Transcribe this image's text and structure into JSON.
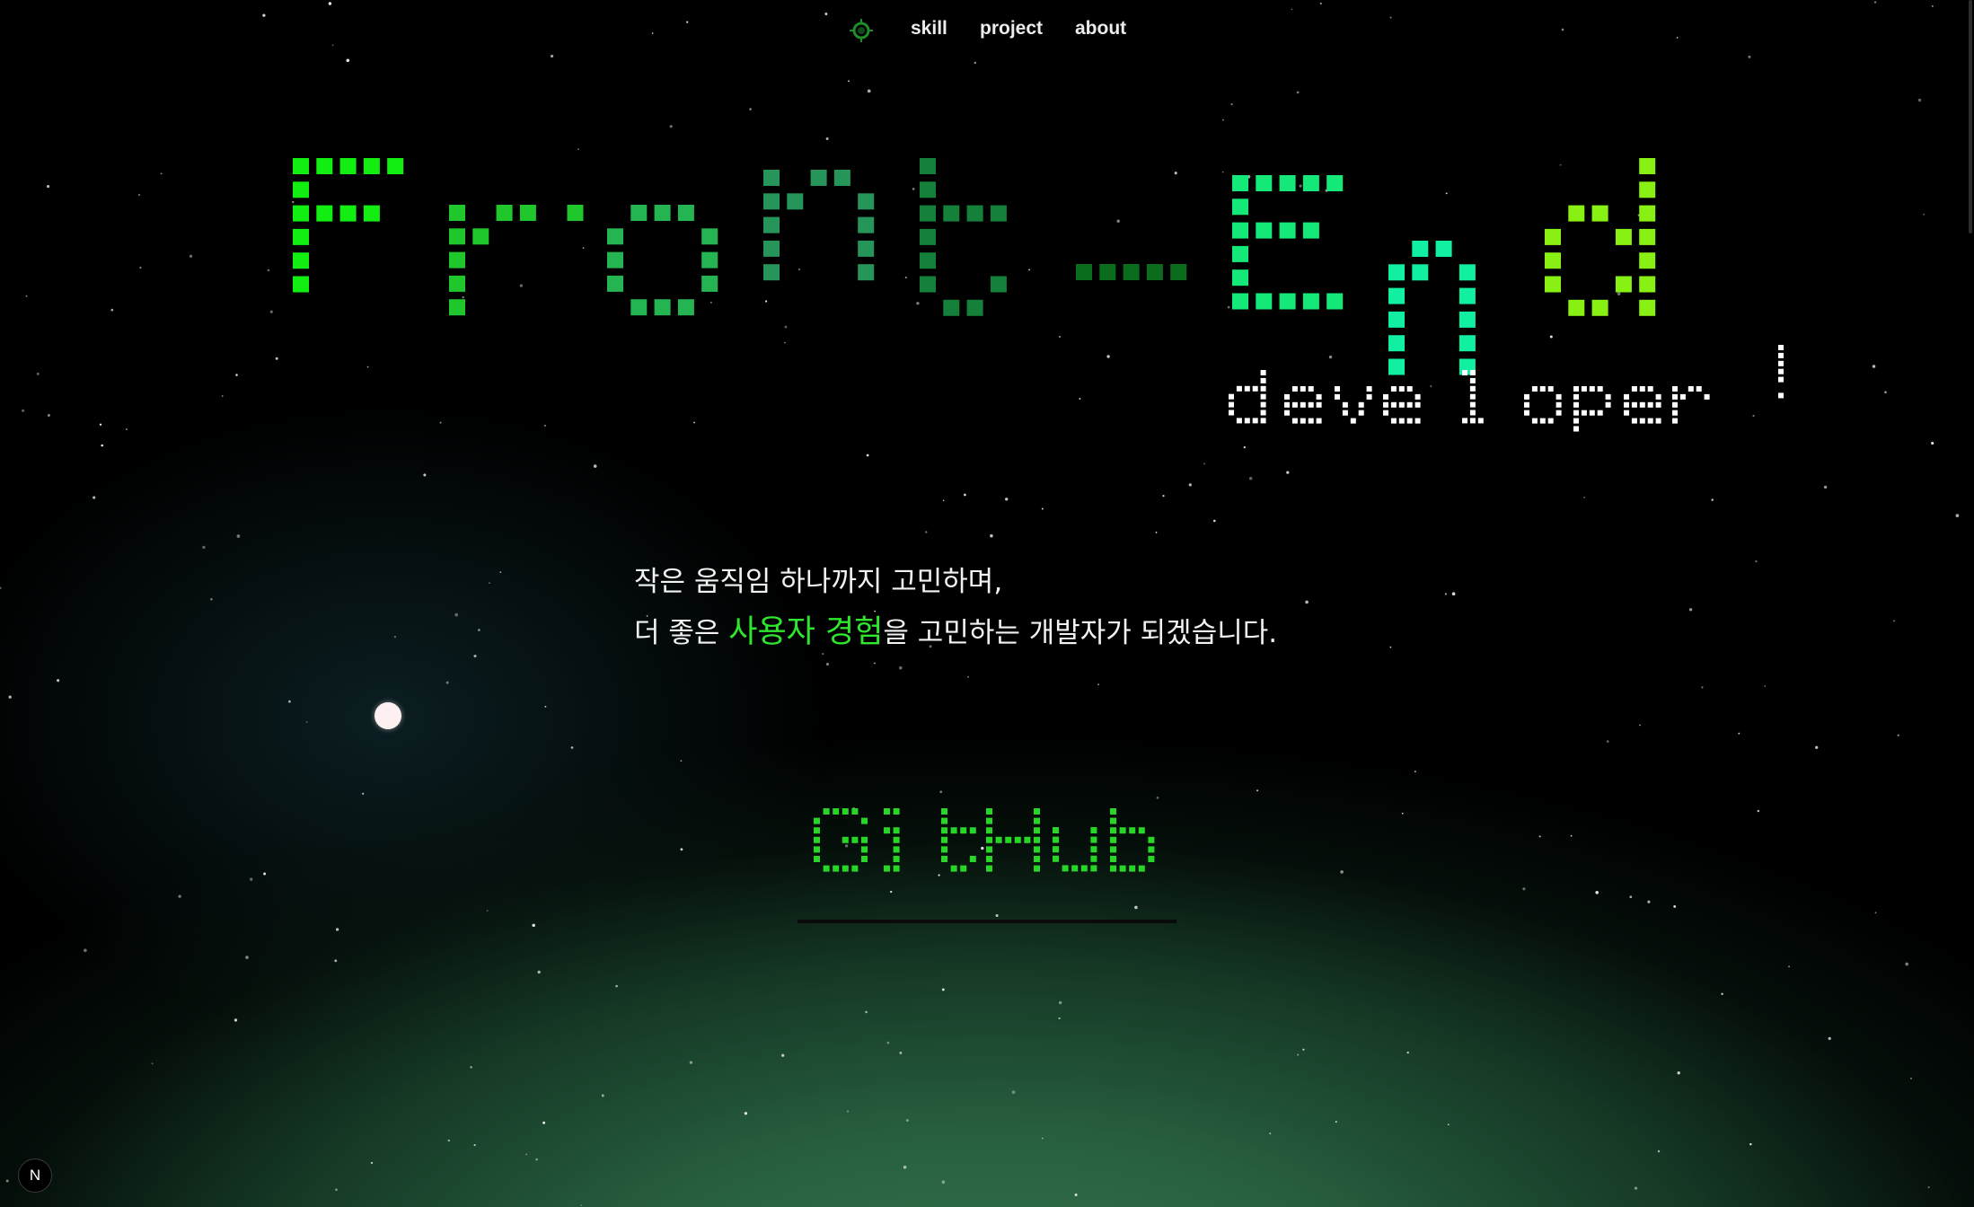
{
  "nav": {
    "items": [
      {
        "label": "skill"
      },
      {
        "label": "project"
      },
      {
        "label": "about"
      }
    ],
    "logo_icon": "compass-icon"
  },
  "hero": {
    "title_main": "Front-End",
    "title_sub": "developer!",
    "title_colors": [
      "#12ee12",
      "#1fc62c",
      "#24b552",
      "#26955a",
      "#15803a",
      "#0b6c1d",
      "#14e879",
      "#10f0a0",
      "#14f08c",
      "#88f012"
    ],
    "sub_color": "#ffffff"
  },
  "tagline": {
    "line1": "작은 움직임 하나까지 고민하며,",
    "line2_pre": "더 좋은 ",
    "line2_highlight": "사용자 경험",
    "line2_post": "을 고민하는 개발자가 되겠습니다.",
    "highlight_color": "#2ee82e"
  },
  "github": {
    "label": "GitHub",
    "color": "#27d627"
  },
  "next_badge": {
    "label": "N"
  }
}
